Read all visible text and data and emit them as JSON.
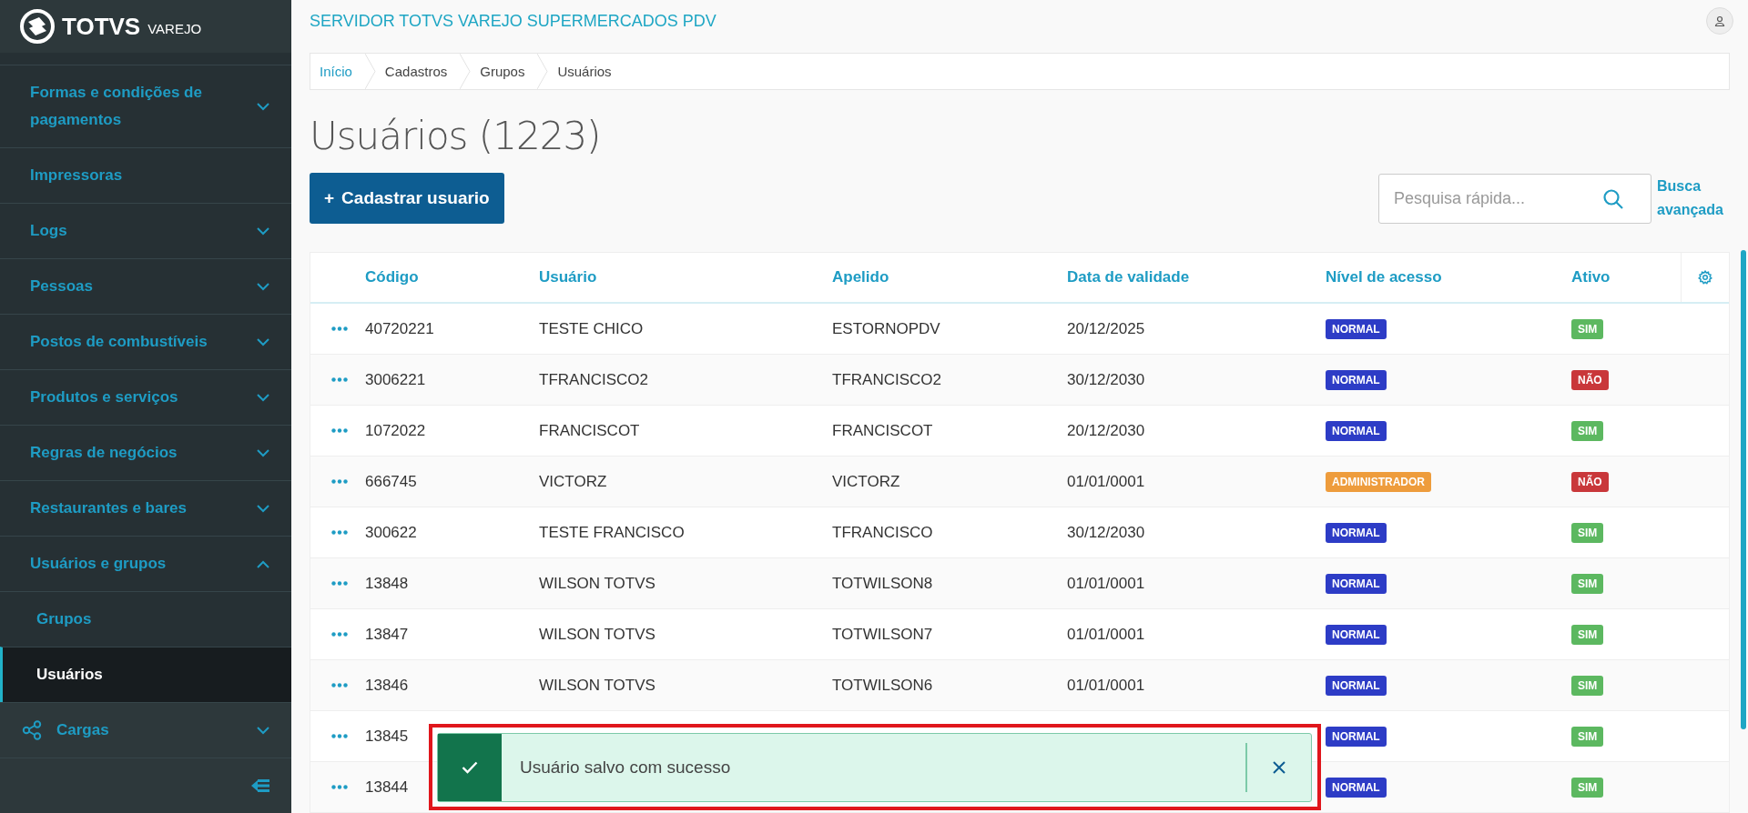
{
  "brand": {
    "name": "TOTVS",
    "product": "VAREJO"
  },
  "sidebar": {
    "items": [
      {
        "label": "Formas e condições de pagamentos",
        "kind": "group",
        "expanded": false
      },
      {
        "label": "Impressoras",
        "kind": "link"
      },
      {
        "label": "Logs",
        "kind": "group",
        "expanded": false
      },
      {
        "label": "Pessoas",
        "kind": "group",
        "expanded": false
      },
      {
        "label": "Postos de combustíveis",
        "kind": "group",
        "expanded": false
      },
      {
        "label": "Produtos e serviços",
        "kind": "group",
        "expanded": false
      },
      {
        "label": "Regras de negócios",
        "kind": "group",
        "expanded": false
      },
      {
        "label": "Restaurantes e bares",
        "kind": "group",
        "expanded": false
      },
      {
        "label": "Usuários e grupos",
        "kind": "group",
        "expanded": true,
        "children": [
          {
            "label": "Grupos",
            "selected": false
          },
          {
            "label": "Usuários",
            "selected": true
          }
        ]
      },
      {
        "label": "Cargas",
        "kind": "module",
        "expanded": false
      }
    ]
  },
  "header": {
    "title": "SERVIDOR TOTVS VAREJO SUPERMERCADOS PDV"
  },
  "breadcrumb": [
    "Início",
    "Cadastros",
    "Grupos",
    "Usuários"
  ],
  "page": {
    "title": "Usuários (1223)",
    "add_button": "Cadastrar usuario",
    "add_icon": "+",
    "search": {
      "placeholder": "Pesquisa rápida..."
    },
    "advanced_search": "Busca avançada"
  },
  "table": {
    "columns": [
      "Código",
      "Usuário",
      "Apelido",
      "Data de validade",
      "Nível de acesso",
      "Ativo"
    ],
    "rows": [
      {
        "codigo": "40720221",
        "usuario": "TESTE CHICO",
        "apelido": "ESTORNOPDV",
        "data": "20/12/2025",
        "nivel": {
          "text": "NORMAL",
          "color": "#2d3cc6"
        },
        "ativo": {
          "text": "SIM",
          "color": "#5cb860"
        }
      },
      {
        "codigo": "3006221",
        "usuario": "TFRANCISCO2",
        "apelido": "TFRANCISCO2",
        "data": "30/12/2030",
        "nivel": {
          "text": "NORMAL",
          "color": "#2d3cc6"
        },
        "ativo": {
          "text": "NÃO",
          "color": "#c9373a"
        }
      },
      {
        "codigo": "1072022",
        "usuario": "FRANCISCOT",
        "apelido": "FRANCISCOT",
        "data": "20/12/2030",
        "nivel": {
          "text": "NORMAL",
          "color": "#2d3cc6"
        },
        "ativo": {
          "text": "SIM",
          "color": "#5cb860"
        }
      },
      {
        "codigo": "666745",
        "usuario": "VICTORZ",
        "apelido": "VICTORZ",
        "data": "01/01/0001",
        "nivel": {
          "text": "ADMINISTRADOR",
          "color": "#ee9c3c"
        },
        "ativo": {
          "text": "NÃO",
          "color": "#c9373a"
        }
      },
      {
        "codigo": "300622",
        "usuario": "TESTE FRANCISCO",
        "apelido": "TFRANCISCO",
        "data": "30/12/2030",
        "nivel": {
          "text": "NORMAL",
          "color": "#2d3cc6"
        },
        "ativo": {
          "text": "SIM",
          "color": "#5cb860"
        }
      },
      {
        "codigo": "13848",
        "usuario": "WILSON TOTVS",
        "apelido": "TOTWILSON8",
        "data": "01/01/0001",
        "nivel": {
          "text": "NORMAL",
          "color": "#2d3cc6"
        },
        "ativo": {
          "text": "SIM",
          "color": "#5cb860"
        }
      },
      {
        "codigo": "13847",
        "usuario": "WILSON TOTVS",
        "apelido": "TOTWILSON7",
        "data": "01/01/0001",
        "nivel": {
          "text": "NORMAL",
          "color": "#2d3cc6"
        },
        "ativo": {
          "text": "SIM",
          "color": "#5cb860"
        }
      },
      {
        "codigo": "13846",
        "usuario": "WILSON TOTVS",
        "apelido": "TOTWILSON6",
        "data": "01/01/0001",
        "nivel": {
          "text": "NORMAL",
          "color": "#2d3cc6"
        },
        "ativo": {
          "text": "SIM",
          "color": "#5cb860"
        }
      },
      {
        "codigo": "13845",
        "nivel": {
          "text": "NORMAL",
          "color": "#2d3cc6"
        },
        "ativo": {
          "text": "SIM",
          "color": "#5cb860"
        }
      },
      {
        "codigo": "13844",
        "nivel": {
          "text": "NORMAL",
          "color": "#2d3cc6"
        },
        "ativo": {
          "text": "SIM",
          "color": "#5cb860"
        }
      }
    ]
  },
  "toast": {
    "message": "Usuário salvo com sucesso",
    "kind": "success"
  }
}
